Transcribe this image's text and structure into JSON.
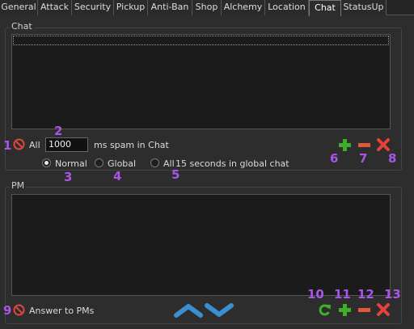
{
  "tabs": [
    {
      "label": "General"
    },
    {
      "label": "Attack"
    },
    {
      "label": "Security"
    },
    {
      "label": "Pickup"
    },
    {
      "label": "Anti-Ban"
    },
    {
      "label": "Shop"
    },
    {
      "label": "Alchemy"
    },
    {
      "label": "Location"
    },
    {
      "label": "Chat",
      "active": true
    },
    {
      "label": "StatusUp"
    }
  ],
  "chat": {
    "group_title": "Chat",
    "all_label": "All",
    "spam_value": "1000",
    "spam_suffix": "ms spam in Chat",
    "radio_normal": "Normal",
    "radio_global": "Global",
    "radio_all": "All",
    "radio_all_suffix": "15 seconds in global chat",
    "selected_mode": "Normal"
  },
  "pm": {
    "group_title": "PM",
    "answer_label": "Answer to PMs"
  },
  "annotations": [
    "1",
    "2",
    "3",
    "4",
    "5",
    "6",
    "7",
    "8",
    "9",
    "10",
    "11",
    "12",
    "13"
  ],
  "colors": {
    "annotation": "#a855e8",
    "add": "#3fae2a",
    "remove": "#e05a3a",
    "delete": "#e8403a",
    "arrow": "#3a8fd0"
  },
  "icons": {
    "block": "block-icon",
    "add": "plus-icon",
    "remove": "minus-icon",
    "delete": "delete-x-icon",
    "refresh": "refresh-icon",
    "up": "chevron-up-icon",
    "down": "chevron-down-icon"
  }
}
